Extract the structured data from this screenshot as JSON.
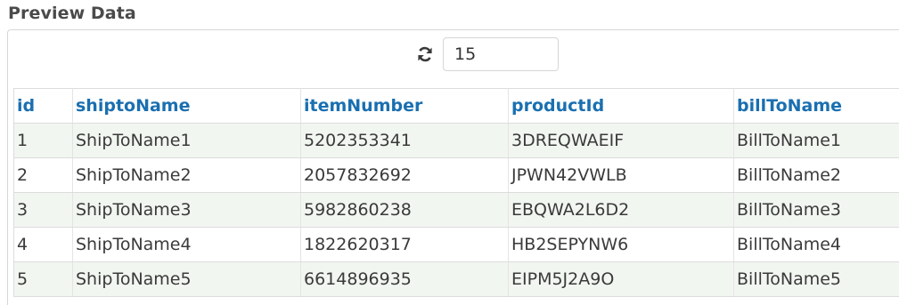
{
  "section": {
    "title": "Preview Data"
  },
  "toolbar": {
    "refresh_icon": "refresh-icon",
    "rows_value": "15"
  },
  "table": {
    "columns": [
      "id",
      "shiptoName",
      "itemNumber",
      "productId",
      "billToName"
    ],
    "rows": [
      [
        "1",
        "ShipToName1",
        "5202353341",
        "3DREQWAEIF",
        "BillToName1"
      ],
      [
        "2",
        "ShipToName2",
        "2057832692",
        "JPWN42VWLB",
        "BillToName2"
      ],
      [
        "3",
        "ShipToName3",
        "5982860238",
        "EBQWA2L6D2",
        "BillToName3"
      ],
      [
        "4",
        "ShipToName4",
        "1822620317",
        "HB2SEPYNW6",
        "BillToName4"
      ],
      [
        "5",
        "ShipToName5",
        "6614896935",
        "EIPM5J2A9O",
        "BillToName5"
      ]
    ]
  },
  "colors": {
    "header_text": "#1a6fb0",
    "stripe": "#f2f6f1",
    "border": "#dcdcdc"
  }
}
